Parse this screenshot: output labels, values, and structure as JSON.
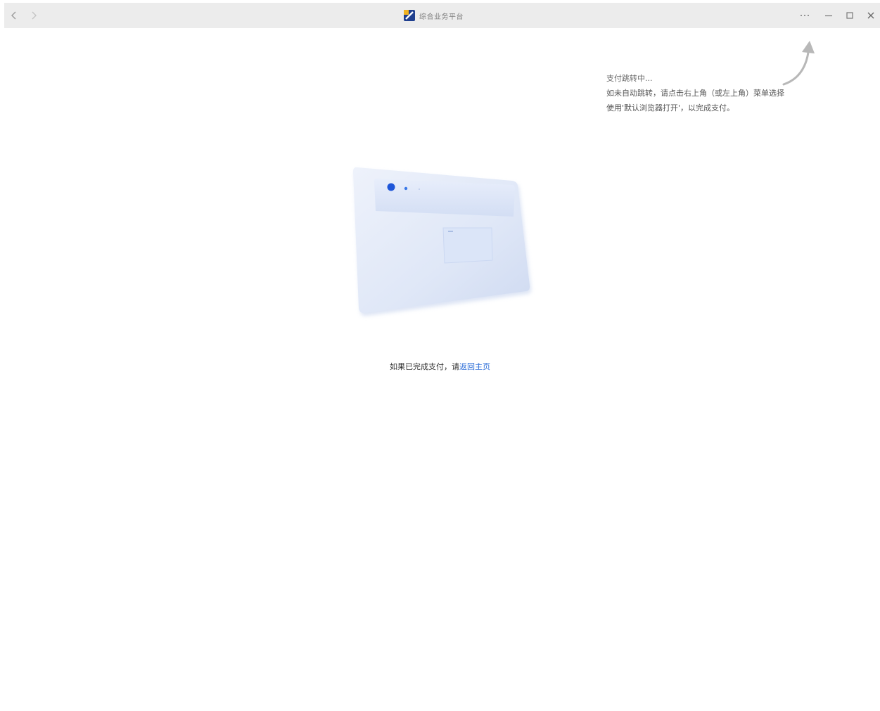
{
  "window": {
    "title": "综合业务平台",
    "back_icon": "chevron-left-icon",
    "forward_icon": "chevron-right-icon",
    "app_logo_icon": "app-logo-icon",
    "controls": {
      "more_icon": "more-horizontal-icon",
      "minimize_icon": "minimize-icon",
      "maximize_icon": "maximize-icon",
      "close_icon": "close-icon"
    }
  },
  "hint": {
    "line1": "支付跳转中...",
    "line2": "如未自动跳转，请点击右上角（或左上角）菜单选择",
    "line3": "使用'默认浏览器打开'，以完成支付。"
  },
  "status": {
    "prefix": "如果已完成支付，请",
    "link": "返回主页"
  },
  "colors": {
    "titlebar": "#ececec",
    "link": "#2f6fd8",
    "illustration_blue": "#1e56d9"
  }
}
